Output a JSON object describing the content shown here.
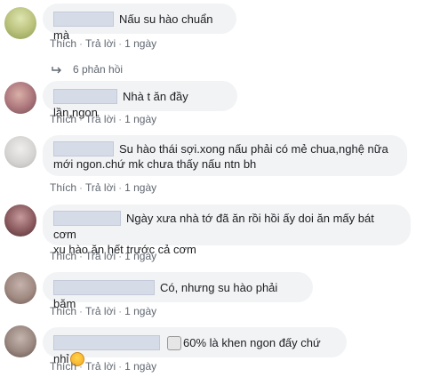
{
  "actions": {
    "like": "Thích",
    "reply": "Trả lời",
    "time": "1 ngày"
  },
  "comments": [
    {
      "text": "Nấu su hào chuẩn mà",
      "avatar_color": "#b8c07a"
    },
    {
      "text": "Nhà t ăn đầy lần,ngon",
      "avatar_color": "#b07a7f"
    },
    {
      "text_line1": "Su hào thái sợi.xong nấu phải có mẻ chua,nghệ nữa",
      "text_line2": "mới ngon.chứ mk chưa thấy nấu ntn bh",
      "avatar_color": "#d4d2d0"
    },
    {
      "text_line1": "Ngày xưa nhà tớ đã ăn rồi hồi ấy doi ăn mấy bát cơm",
      "text_line2": "xu hào ăn hết trước cả cơm",
      "avatar_color": "#8a5a5e"
    },
    {
      "text": "Có, nhưng su hào phải băm",
      "avatar_color": "#a08a82"
    },
    {
      "text_before": "60% là khen ngon đấy chứ nhỉ",
      "avatar_color": "#9a8880"
    }
  ],
  "replies_label": "6 phản hồi"
}
